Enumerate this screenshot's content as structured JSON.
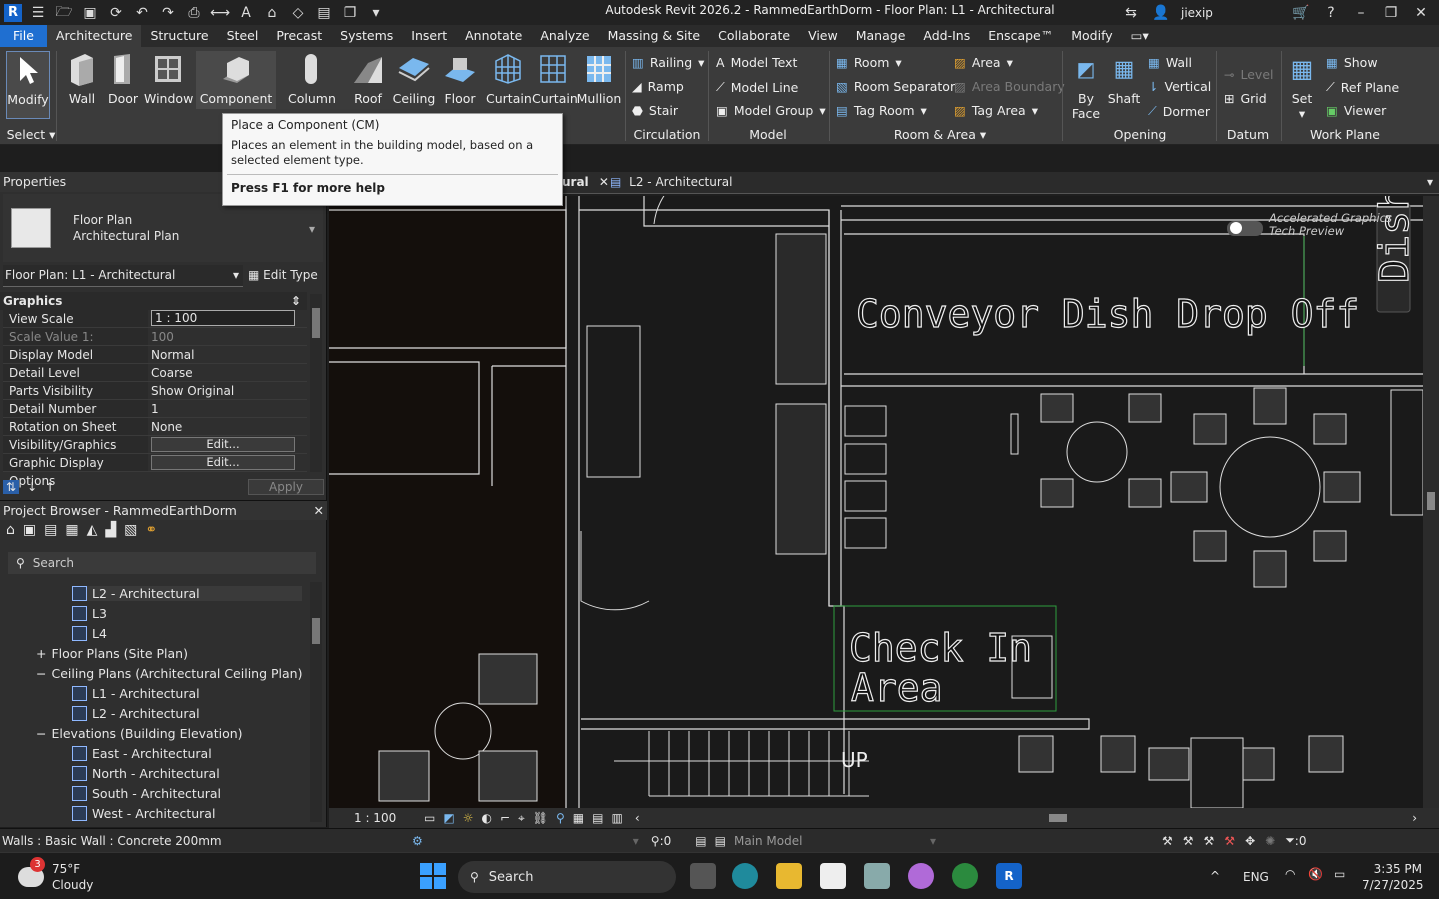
{
  "window": {
    "title": "Autodesk Revit 2026.2 - RammedEarthDorm - Floor Plan: L1 - Architectural",
    "user": "jiexip"
  },
  "tabs": [
    "File",
    "Architecture",
    "Structure",
    "Steel",
    "Precast",
    "Systems",
    "Insert",
    "Annotate",
    "Analyze",
    "Massing & Site",
    "Collaborate",
    "View",
    "Manage",
    "Add-Ins",
    "Enscape™",
    "Modify"
  ],
  "ribbon": {
    "select": {
      "modify": "Modify",
      "panel": "Select"
    },
    "build": {
      "wall": "Wall",
      "door": "Door",
      "window": "Window",
      "component": "Component",
      "column": "Column",
      "roof": "Roof",
      "ceiling": "Ceiling",
      "floor": "Floor",
      "curtain1": "Curtain",
      "curtain2": "Curtain",
      "mullion": "Mullion"
    },
    "circulation": {
      "railing": "Railing",
      "ramp": "Ramp",
      "stair": "Stair",
      "panel": "Circulation"
    },
    "model": {
      "text": "Model  Text",
      "line": "Model  Line",
      "group": "Model  Group",
      "panel": "Model"
    },
    "room": {
      "room": "Room",
      "separator": "Room  Separator",
      "tag_room": "Tag  Room",
      "area": "Area",
      "area_boundary": "Area  Boundary",
      "tag_area": "Tag  Area",
      "panel": "Room & Area"
    },
    "opening": {
      "by_face_1": "By",
      "by_face_2": "Face",
      "shaft": "Shaft",
      "wall": "Wall",
      "vertical": "Vertical",
      "dormer": "Dormer",
      "panel": "Opening"
    },
    "datum": {
      "level": "Level",
      "grid": "Grid",
      "panel": "Datum"
    },
    "workplane": {
      "set": "Set",
      "show": "Show",
      "ref_plane": "Ref  Plane",
      "viewer": "Viewer",
      "panel": "Work Plane"
    }
  },
  "tooltip": {
    "title": "Place a Component (CM)",
    "body": "Places an element in the building model, based on a selected element type.",
    "help": "Press F1 for more help"
  },
  "properties": {
    "header": "Properties",
    "type_line1": "Floor Plan",
    "type_line2": "Architectural Plan",
    "selector": "Floor Plan: L1 - Architectural",
    "edit_type": "Edit Type",
    "section": "Graphics",
    "rows": [
      {
        "k": "View Scale",
        "v": "1 : 100"
      },
      {
        "k": "Scale Value    1:",
        "v": "100"
      },
      {
        "k": "Display Model",
        "v": "Normal"
      },
      {
        "k": "Detail Level",
        "v": "Coarse"
      },
      {
        "k": "Parts Visibility",
        "v": "Show Original"
      },
      {
        "k": "Detail Number",
        "v": "1"
      },
      {
        "k": "Rotation on Sheet",
        "v": "None"
      },
      {
        "k": "Visibility/Graphics Overr...",
        "v": "Edit..."
      },
      {
        "k": "Graphic Display Options",
        "v": "Edit..."
      }
    ],
    "apply": "Apply"
  },
  "browser": {
    "header": "Project Browser - RammedEarthDorm",
    "search_placeholder": "Search",
    "items": [
      {
        "t": "L2 - Architectural",
        "lvl": 3,
        "icon": true
      },
      {
        "t": "L3",
        "lvl": 3,
        "icon": true
      },
      {
        "t": "L4",
        "lvl": 3,
        "icon": true
      },
      {
        "t": "Floor Plans (Site Plan)",
        "lvl": 1,
        "sign": "+"
      },
      {
        "t": "Ceiling Plans (Architectural Ceiling Plan)",
        "lvl": 1,
        "sign": "−"
      },
      {
        "t": "L1 - Architectural",
        "lvl": 3,
        "icon": true
      },
      {
        "t": "L2 - Architectural",
        "lvl": 3,
        "icon": true
      },
      {
        "t": "Elevations (Building Elevation)",
        "lvl": 1,
        "sign": "−"
      },
      {
        "t": "East - Architectural",
        "lvl": 3,
        "icon": true
      },
      {
        "t": "North - Architectural",
        "lvl": 3,
        "icon": true
      },
      {
        "t": "South - Architectural",
        "lvl": 3,
        "icon": true
      },
      {
        "t": "West - Architectural",
        "lvl": 3,
        "icon": true
      }
    ]
  },
  "view_tabs": {
    "tab1_partial": "ural",
    "tab2": "L2 - Architectural"
  },
  "canvas": {
    "room1": "Conveyor Dish Drop Off",
    "room2a": "Check In",
    "room2b": "Area",
    "up": "UP",
    "side_label": "Dish",
    "accel1": "Accelerated Graphics",
    "accel2": "Tech Preview"
  },
  "view_status": {
    "scale": "1 : 100",
    "main_model": "Main Model",
    "zero": ":0"
  },
  "status": {
    "text": "Walls : Basic Wall : Concrete 200mm",
    "filter": ":0"
  },
  "taskbar": {
    "temp": "75°F",
    "weather": "Cloudy",
    "badge": "3",
    "search": "Search",
    "lang": "ENG",
    "time": "3:35 PM",
    "date": "7/27/2025"
  }
}
